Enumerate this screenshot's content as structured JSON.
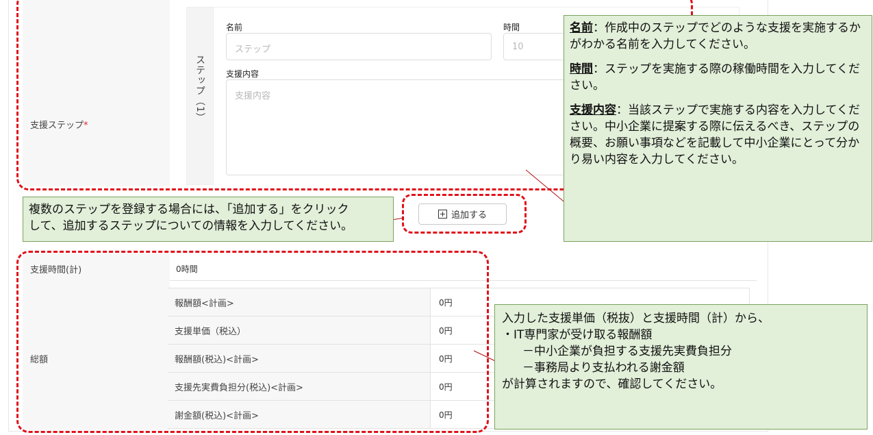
{
  "form": {
    "support_steps_label": "支援ステップ",
    "required_mark": "*",
    "step_side_label": "ステップ（1）",
    "name_field": {
      "title": "名前",
      "placeholder": "ステップ"
    },
    "time_field": {
      "title": "時間",
      "placeholder": "10"
    },
    "content_field": {
      "title": "支援内容",
      "placeholder": "支援内容"
    },
    "add_button_label": "追加する",
    "total_time": {
      "label": "支援時間(計)",
      "value": "0時間"
    },
    "total_amount_label": "総額",
    "amount_rows": [
      {
        "label": "報酬額<計画>",
        "value": "0円"
      },
      {
        "label": "支援単価（税込）",
        "value": "0円"
      },
      {
        "label": "報酬額(税込)<計画>",
        "value": "0円"
      },
      {
        "label": "支援先実費負担分(税込)<計画>",
        "value": "0円"
      },
      {
        "label": "謝金額(税込)<計画>",
        "value": "0円"
      }
    ]
  },
  "callouts": {
    "fields": {
      "name_term": "名前",
      "name_text": "：作成中のステップでどのような支援を実施するかがわかる名前を入力してください。",
      "time_term": "時間",
      "time_text": "：ステップを実施する際の稼働時間を入力してください。",
      "content_term": "支援内容",
      "content_text": "：当該ステップで実施する内容を入力してください。中小企業に提案する際に伝えるべき、ステップの概要、お願い事項などを記載して中小企業にとって分かり易い内容を入力してください。"
    },
    "add": {
      "line1": "複数のステップを登録する場合には、「追加する」をクリック",
      "line2": "して、追加するステップについての情報を入力してください。"
    },
    "totals": {
      "line1": "入力した支援単価（税抜）と支援時間（計）から、",
      "line2": "・IT専門家が受け取る報酬額",
      "line3": "－中小企業が負担する支援先実費負担分",
      "line4": "－事務局より支払われる謝金額",
      "line5": "が計算されますので、確認してください。"
    }
  },
  "colors": {
    "annotation_border": "#e0101a",
    "callout_bg": "#e2efd9",
    "required": "#e0262c"
  }
}
